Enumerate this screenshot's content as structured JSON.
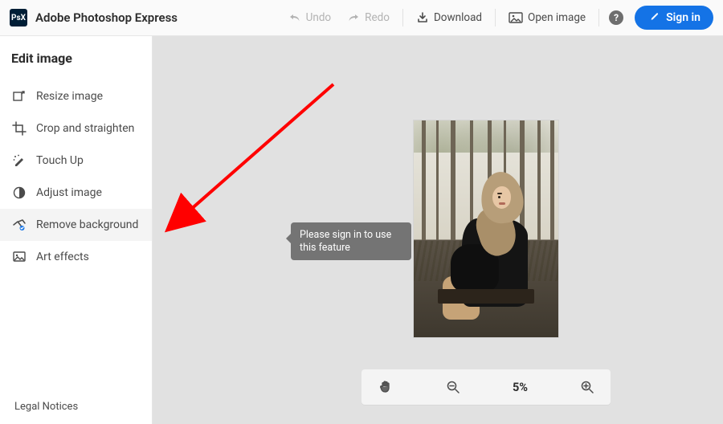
{
  "header": {
    "app_title": "Adobe Photoshop Express",
    "logo_text": "PsX",
    "undo": "Undo",
    "redo": "Redo",
    "download": "Download",
    "open_image": "Open image",
    "help": "?",
    "signin": "Sign in"
  },
  "sidebar": {
    "title": "Edit image",
    "items": [
      {
        "label": "Resize image",
        "icon": "resize-icon"
      },
      {
        "label": "Crop and straighten",
        "icon": "crop-icon"
      },
      {
        "label": "Touch Up",
        "icon": "touchup-icon"
      },
      {
        "label": "Adjust image",
        "icon": "adjust-icon"
      },
      {
        "label": "Remove background",
        "icon": "remove-bg-icon"
      },
      {
        "label": "Art effects",
        "icon": "art-effects-icon"
      }
    ],
    "legal": "Legal Notices"
  },
  "tooltip": {
    "text": "Please sign in to use this feature"
  },
  "zoom": {
    "value": "5%"
  },
  "colors": {
    "accent": "#1473e6",
    "tooltip_bg": "#747474",
    "canvas_bg": "#e1e1e1",
    "annotation": "#ff0000"
  }
}
